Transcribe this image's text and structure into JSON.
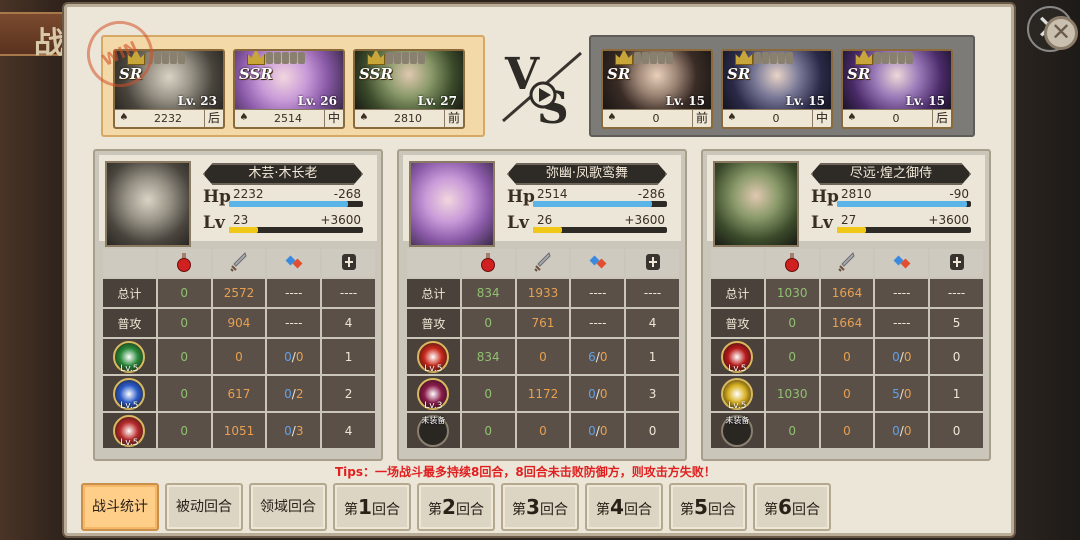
{
  "bg_title": "战",
  "close_glyph": "✕",
  "left_team": [
    {
      "rarity": "SR",
      "level": "Lv. 23",
      "power": "2232",
      "position": "后",
      "portrait": "p-elder"
    },
    {
      "rarity": "SSR",
      "level": "Lv. 26",
      "power": "2514",
      "position": "中",
      "portrait": "p-purple"
    },
    {
      "rarity": "SSR",
      "level": "Lv. 27",
      "power": "2810",
      "position": "前",
      "portrait": "p-green"
    }
  ],
  "right_team": [
    {
      "rarity": "SR",
      "level": "Lv. 15",
      "power": "0",
      "position": "前",
      "portrait": "p-man1"
    },
    {
      "rarity": "SR",
      "level": "Lv. 15",
      "power": "0",
      "position": "中",
      "portrait": "p-man2"
    },
    {
      "rarity": "SR",
      "level": "Lv. 15",
      "power": "0",
      "position": "后",
      "portrait": "p-man3"
    }
  ],
  "panels": [
    {
      "name": "木芸·木长老",
      "hp": "2232",
      "hp_delta": "-268",
      "hp_fraction": 0.89,
      "lv": "23",
      "lv_delta": "+3600",
      "lv_fraction": 0.22,
      "portrait": "p-elder",
      "rows": [
        {
          "label": "总计",
          "v1": "0",
          "v2": "2572",
          "v3": "----",
          "v4": "----"
        },
        {
          "label": "普攻",
          "v1": "0",
          "v2": "904",
          "v3": "----",
          "v4": "4"
        }
      ],
      "skills": [
        {
          "lv": "Lv.5",
          "v1": "0",
          "v2": "0",
          "v3a": "0",
          "v3b": "0",
          "v4": "1",
          "color": "#2a8a3a"
        },
        {
          "lv": "Lv.5",
          "v1": "0",
          "v2": "617",
          "v3a": "0",
          "v3b": "2",
          "v4": "2",
          "color": "#2a5ac8"
        },
        {
          "lv": "Lv.5",
          "v1": "0",
          "v2": "1051",
          "v3a": "0",
          "v3b": "3",
          "v4": "4",
          "color": "#b82a2a"
        }
      ]
    },
    {
      "name": "弥幽·凤歌鸾舞",
      "hp": "2514",
      "hp_delta": "-286",
      "hp_fraction": 0.89,
      "lv": "26",
      "lv_delta": "+3600",
      "lv_fraction": 0.22,
      "portrait": "p-purple",
      "rows": [
        {
          "label": "总计",
          "v1": "834",
          "v2": "1933",
          "v3": "----",
          "v4": "----"
        },
        {
          "label": "普攻",
          "v1": "0",
          "v2": "761",
          "v3": "----",
          "v4": "4"
        }
      ],
      "skills": [
        {
          "lv": "Lv.5",
          "v1": "834",
          "v2": "0",
          "v3a": "6",
          "v3b": "0",
          "v4": "1",
          "color": "#c8281a"
        },
        {
          "lv": "Lv.3",
          "v1": "0",
          "v2": "1172",
          "v3a": "0",
          "v3b": "0",
          "v4": "3",
          "color": "#8a1a4a"
        },
        {
          "lv": "未装备",
          "v1": "0",
          "v2": "0",
          "v3a": "0",
          "v3b": "0",
          "v4": "0",
          "color": "",
          "empty": true
        }
      ]
    },
    {
      "name": "尽远·煌之御侍",
      "hp": "2810",
      "hp_delta": "-90",
      "hp_fraction": 0.97,
      "lv": "27",
      "lv_delta": "+3600",
      "lv_fraction": 0.22,
      "portrait": "p-green",
      "rows": [
        {
          "label": "总计",
          "v1": "1030",
          "v2": "1664",
          "v3": "----",
          "v4": "----"
        },
        {
          "label": "普攻",
          "v1": "0",
          "v2": "1664",
          "v3": "----",
          "v4": "5"
        }
      ],
      "skills": [
        {
          "lv": "Lv.5",
          "v1": "0",
          "v2": "0",
          "v3a": "0",
          "v3b": "0",
          "v4": "0",
          "color": "#b81a1a"
        },
        {
          "lv": "Lv.5",
          "v1": "1030",
          "v2": "0",
          "v3a": "5",
          "v3b": "0",
          "v4": "1",
          "color": "#d8b020"
        },
        {
          "lv": "未装备",
          "v1": "0",
          "v2": "0",
          "v3a": "0",
          "v3b": "0",
          "v4": "0",
          "color": "",
          "empty": true
        }
      ]
    }
  ],
  "tips": "Tips：一场战斗最多持续8回合，8回合未击败防御方，则攻击方失败！",
  "tabs": [
    {
      "label": "战斗统计",
      "active": true
    },
    {
      "label": "被动回合"
    },
    {
      "label": "领域回合"
    },
    {
      "pre": "第",
      "num": "1",
      "post": "回合"
    },
    {
      "pre": "第",
      "num": "2",
      "post": "回合"
    },
    {
      "pre": "第",
      "num": "3",
      "post": "回合"
    },
    {
      "pre": "第",
      "num": "4",
      "post": "回合"
    },
    {
      "pre": "第",
      "num": "5",
      "post": "回合"
    },
    {
      "pre": "第",
      "num": "6",
      "post": "回合"
    }
  ],
  "colors": {
    "hp_bar": "#5ab4e8",
    "lv_bar": "#f2c818",
    "tips": "#e02020",
    "active_tab": "#ffcf8a"
  }
}
